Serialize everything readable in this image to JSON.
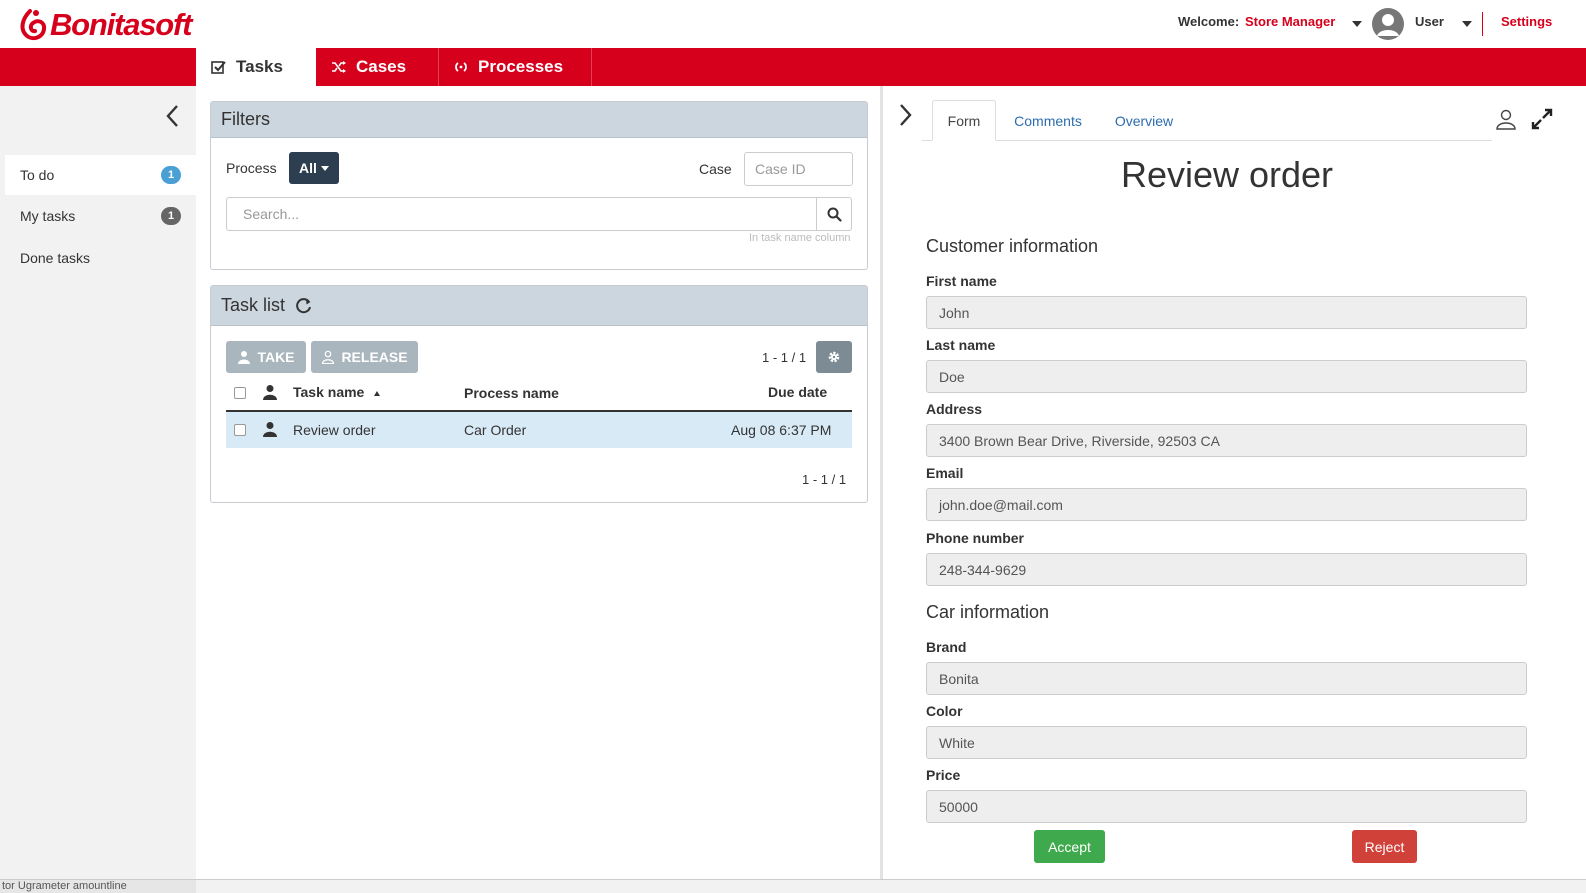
{
  "brand": {
    "name": "Bonitasoft",
    "accent": "#d6001c"
  },
  "header": {
    "welcome_label": "Welcome:",
    "profile_name": "Store Manager",
    "user_label": "User",
    "settings_label": "Settings"
  },
  "nav": {
    "tabs": [
      {
        "label": "Tasks",
        "icon": "checkbox-icon",
        "active": true
      },
      {
        "label": "Cases",
        "icon": "shuffle-icon",
        "active": false
      },
      {
        "label": "Processes",
        "icon": "process-icon",
        "active": false
      }
    ]
  },
  "sidebar": {
    "items": [
      {
        "label": "To do",
        "count": "1",
        "active": true,
        "badge_color": "#4a9fd5"
      },
      {
        "label": "My tasks",
        "count": "1",
        "active": false,
        "badge_color": "#666666"
      },
      {
        "label": "Done tasks",
        "active": false
      }
    ]
  },
  "filters": {
    "title": "Filters",
    "process_label": "Process",
    "process_value": "All",
    "case_label": "Case",
    "case_placeholder": "Case ID",
    "search_placeholder": "Search...",
    "search_hint": "In task name column"
  },
  "task_list": {
    "title": "Task list",
    "take_label": "TAKE",
    "release_label": "RELEASE",
    "pagination_top": "1 - 1 / 1",
    "pagination_bottom": "1 - 1 / 1",
    "columns": {
      "task_name": "Task name",
      "process_name": "Process name",
      "due_date": "Due date"
    },
    "rows": [
      {
        "task_name": "Review order",
        "process_name": "Car Order",
        "due_date": "Aug 08 6:37 PM"
      }
    ]
  },
  "details": {
    "tabs": [
      {
        "label": "Form",
        "active": true
      },
      {
        "label": "Comments",
        "active": false
      },
      {
        "label": "Overview",
        "active": false
      }
    ],
    "form_title": "Review order",
    "customer_section": "Customer information",
    "car_section": "Car information",
    "fields": {
      "first_name": {
        "label": "First name",
        "value": "John"
      },
      "last_name": {
        "label": "Last name",
        "value": "Doe"
      },
      "address": {
        "label": "Address",
        "value": "3400 Brown Bear Drive, Riverside, 92503 CA"
      },
      "email": {
        "label": "Email",
        "value": "john.doe@mail.com"
      },
      "phone": {
        "label": "Phone number",
        "value": "248-344-9629"
      },
      "brand": {
        "label": "Brand",
        "value": "Bonita"
      },
      "color": {
        "label": "Color",
        "value": "White"
      },
      "price": {
        "label": "Price",
        "value": "50000"
      }
    },
    "accept_label": "Accept",
    "reject_label": "Reject"
  },
  "footer": {
    "cut_text": "tor Ugrameter amountline"
  }
}
